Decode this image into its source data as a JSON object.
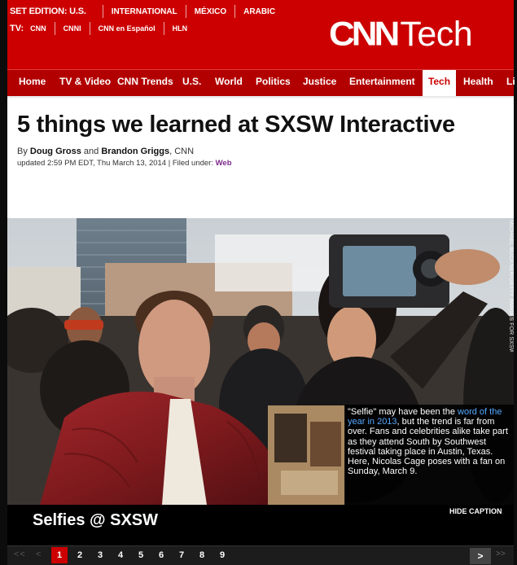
{
  "header": {
    "edition": {
      "label": "SET EDITION: U.S.",
      "links": [
        "INTERNATIONAL",
        "MÉXICO",
        "ARABIC"
      ]
    },
    "tv": {
      "label": "TV:",
      "links": [
        "CNN",
        "CNNI",
        "CNN en Español",
        "HLN"
      ]
    },
    "logo": {
      "brand": "CNN",
      "section": "Tech"
    }
  },
  "nav": {
    "items": [
      "Home",
      "TV & Video",
      "CNN Trends",
      "U.S.",
      "World",
      "Politics",
      "Justice",
      "Entertainment",
      "Tech",
      "Health",
      "Li"
    ],
    "active": "Tech"
  },
  "article": {
    "headline": "5 things we learned at SXSW Interactive",
    "byline": {
      "prefix": "By",
      "author1": "Doug Gross",
      "and": "and",
      "author2": "Brandon Griggs",
      "outlet": ", CNN"
    },
    "updated": "updated 2:59 PM EDT, Thu March 13, 2014 | Filed under:",
    "category": "Web"
  },
  "gallery": {
    "photo_credit": "MICHAEL BUCKNER/GETTY IMAGES FOR SXSW",
    "caption_part1": "\"Selfie\" may have been the",
    "caption_link": "word of the year in 2013",
    "caption_part2": ", but the trend is far from over. Fans and celebrities alike take part as they attend South by Southwest festival taking place in Austin, Texas. Here, Nicolas Cage poses with a fan on Sunday, March 9.",
    "title": "Selfies @ SXSW",
    "hide_caption": "HIDE CAPTION",
    "pager": {
      "first": "<<",
      "prev": "<",
      "pages": [
        "1",
        "2",
        "3",
        "4",
        "5",
        "6",
        "7",
        "8",
        "9"
      ],
      "current": "1",
      "next": ">",
      "last": ">>"
    }
  },
  "colors": {
    "brand_red": "#cc0000",
    "nav_red": "#b20000",
    "link_blue": "#54a8ff",
    "category_purple": "#7c2a8a"
  }
}
